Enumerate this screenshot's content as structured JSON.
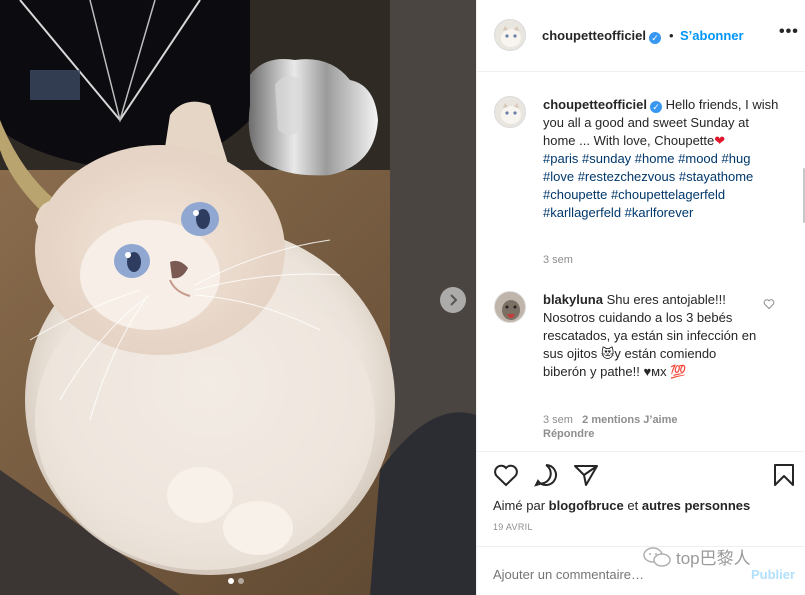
{
  "post": {
    "username": "choupetteofficiel",
    "separator": "•",
    "follow_label": "S’abonner",
    "more_label": "•••"
  },
  "caption": {
    "username": "choupetteofficiel",
    "text": "Hello friends, I wish you all a good and sweet Sunday at home ... With love, Choupette",
    "heart": "❤",
    "hashtags": "#paris #sunday #home #mood #hug #love #restezchezvous #stayathome #choupette #choupettelagerfeld #karllagerfeld #karlforever",
    "time": "3 sem"
  },
  "comment": {
    "username": "blakyluna",
    "text": "Shu eres antojable!!! Nosotros cuidando a los 3 bebés rescatados, ya están sin infección en sus ojitos",
    "emoji1": "😻",
    "text2": "y están comiendo biberón y pathe!! ♥ᴍx",
    "emoji2": "💯",
    "time": "3 sem",
    "likes": "2 mentions J’aime",
    "reply_label": "Répondre"
  },
  "likes": {
    "prefix": "Aimé par",
    "user": "blogofbruce",
    "middle": "et",
    "others": "autres personnes"
  },
  "date": "19 AVRIL",
  "add_comment": {
    "placeholder": "Ajouter un commentaire…",
    "publish_label": "Publier"
  },
  "watermark": "top巴黎人",
  "carousel": {
    "count": 2,
    "active": 0
  },
  "colors": {
    "link": "#0095f6",
    "hashtag": "#00376b",
    "verified": "#3897f0",
    "heart": "#e0162b"
  }
}
